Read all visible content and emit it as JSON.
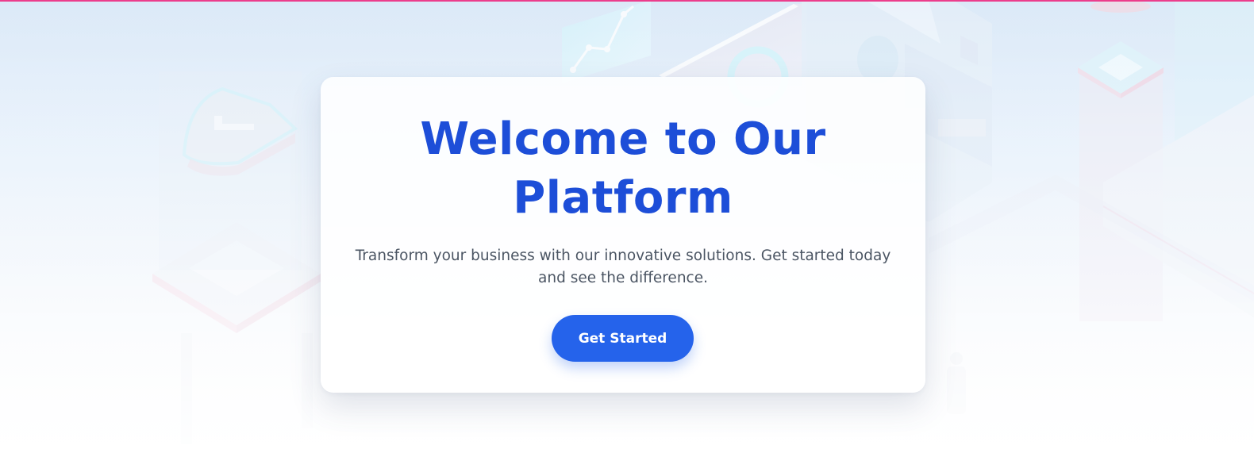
{
  "hero": {
    "title": "Welcome to Our Platform",
    "subtitle": "Transform your business with our innovative solutions. Get started today and see the difference.",
    "cta_label": "Get Started"
  },
  "colors": {
    "primary": "#2563eb",
    "title": "#1d4ed8",
    "accent_bar": "#ec3d8c",
    "text_muted": "#4b5563"
  }
}
